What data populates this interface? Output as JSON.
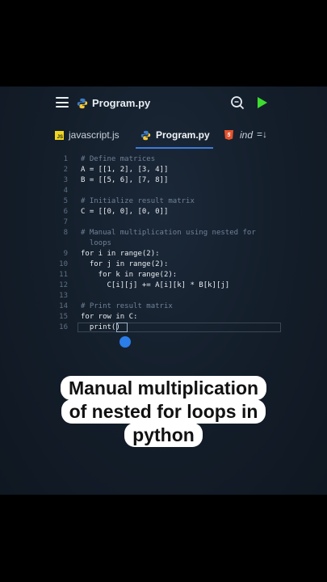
{
  "header": {
    "title": "Program.py",
    "menu_icon": "hamburger-menu-icon",
    "search_icon": "search-icon",
    "run_icon": "play-icon"
  },
  "tabs": [
    {
      "label": "javascript.js",
      "icon": "js-file-icon",
      "active": false
    },
    {
      "label": "Program.py",
      "icon": "python-icon",
      "active": true
    },
    {
      "label": "ind",
      "icon": "html5-icon",
      "active": false
    }
  ],
  "sort_icon_label": "=↓",
  "code_lines": [
    {
      "n": "1",
      "text": "# Define matrices",
      "comment": true
    },
    {
      "n": "2",
      "text": "A = [[1, 2], [3, 4]]",
      "comment": false
    },
    {
      "n": "3",
      "text": "B = [[5, 6], [7, 8]]",
      "comment": false
    },
    {
      "n": "4",
      "text": "",
      "comment": false
    },
    {
      "n": "5",
      "text": "# Initialize result matrix",
      "comment": true
    },
    {
      "n": "6",
      "text": "C = [[0, 0], [0, 0]]",
      "comment": false
    },
    {
      "n": "7",
      "text": "",
      "comment": false
    },
    {
      "n": "8",
      "text": "# Manual multiplication using nested for",
      "comment": true
    },
    {
      "n": "",
      "text": "  loops",
      "comment": true
    },
    {
      "n": "9",
      "text": "for i in range(2):",
      "comment": false
    },
    {
      "n": "10",
      "text": "  for j in range(2):",
      "comment": false
    },
    {
      "n": "11",
      "text": "    for k in range(2):",
      "comment": false
    },
    {
      "n": "12",
      "text": "      C[i][j] += A[i][k] * B[k][j]",
      "comment": false
    },
    {
      "n": "13",
      "text": "",
      "comment": false
    },
    {
      "n": "14",
      "text": "# Print result matrix",
      "comment": true
    },
    {
      "n": "15",
      "text": "for row in C:",
      "comment": false
    },
    {
      "n": "16",
      "text": "  print()",
      "comment": false
    }
  ],
  "caption": [
    "Manual multiplication",
    "of nested for loops in",
    "python"
  ],
  "colors": {
    "accent": "#2b7de9",
    "run": "#3ddc2f",
    "background": "#131d29"
  }
}
